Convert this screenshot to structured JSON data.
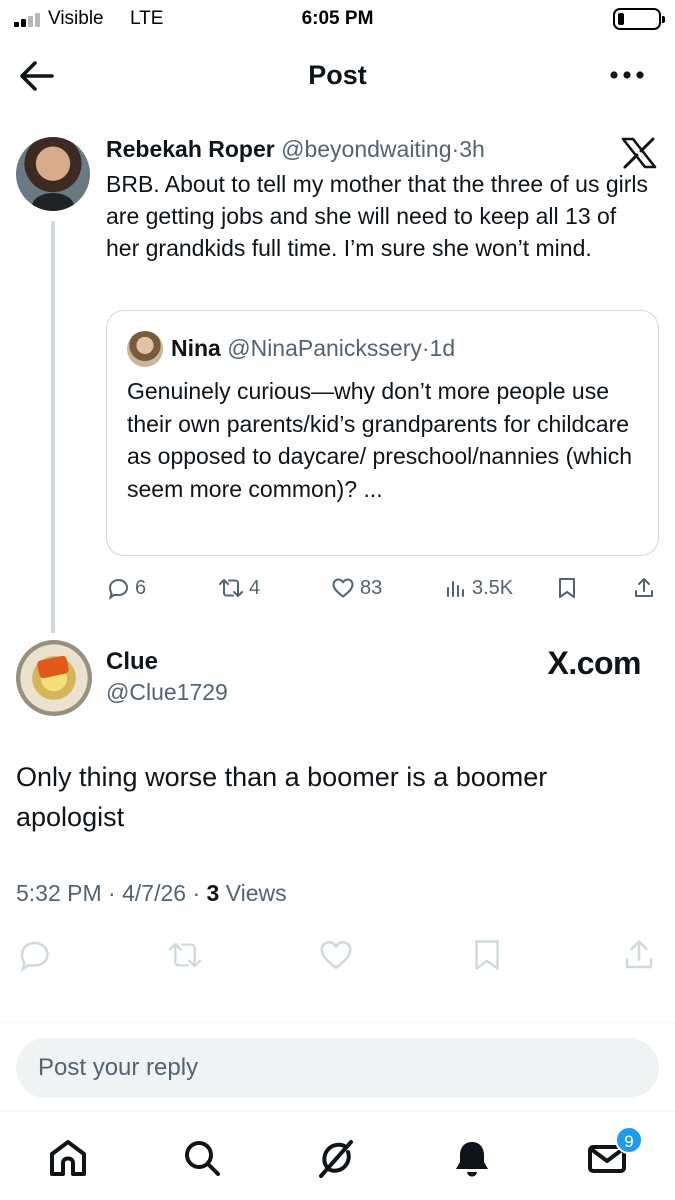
{
  "status_bar": {
    "carrier": "Visible",
    "network": "LTE",
    "time": "6:05 PM",
    "battery_level": 0.15
  },
  "header": {
    "title": "Post",
    "back_icon": "arrow-left-icon",
    "more_icon": "more-horizontal-icon"
  },
  "context_tweet": {
    "author_name": "Rebekah Roper",
    "author_handle": "@beyondwaiting",
    "separator": "·",
    "age": "3h",
    "text": "BRB. About to tell my mother that the three of us girls are getting jobs and she will need to keep all 13 of her grandkids full time. I’m sure she won’t mind.",
    "quote": {
      "author_name": "Nina",
      "author_handle": "@NinaPanickssery",
      "separator": "·",
      "age": "1d",
      "text": "Genuinely curious—why don’t more people use their own parents/kid’s grandparents for childcare as opposed to daycare/ preschool/nannies (which seem more common)? ..."
    },
    "actions": {
      "replies": "6",
      "reposts": "4",
      "likes": "83",
      "views": "3.5K"
    }
  },
  "main_tweet": {
    "author_name": "Clue",
    "author_handle": "@Clue1729",
    "watermark": "X.com",
    "text": "Only thing worse than a boomer is a boomer apologist",
    "time": "5:32 PM",
    "date": "4/7/26",
    "separator": "·",
    "views_count": "3",
    "views_label": "Views"
  },
  "reply_box": {
    "placeholder": "Post your reply"
  },
  "tab_bar": {
    "items": [
      "home-icon",
      "search-icon",
      "grok-icon",
      "notifications-icon",
      "messages-icon"
    ],
    "messages_badge": "9"
  },
  "colors": {
    "text": "#0f1419",
    "muted": "#536471",
    "border": "#cfd9de",
    "accent": "#1d9bf0"
  }
}
